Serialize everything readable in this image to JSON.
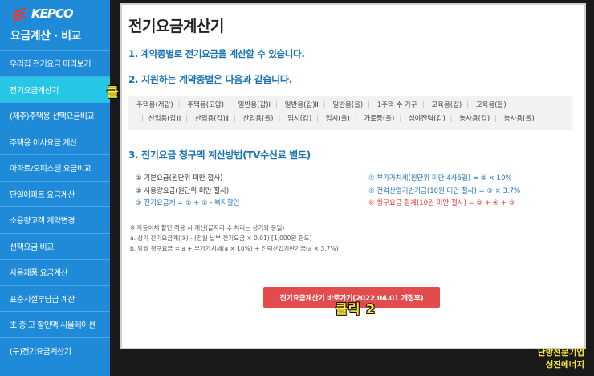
{
  "sidebar": {
    "logo_text": "KEPCO",
    "subtitle": "요금계산 · 비교",
    "items": [
      {
        "label": "우리집 전기요금 미리보기"
      },
      {
        "label": "전기요금계산기"
      },
      {
        "label": "(제주)주택용 선택요금비교"
      },
      {
        "label": "주택용 이사요금 계산"
      },
      {
        "label": "아파트/오피스텔 요금비교"
      },
      {
        "label": "단일아파트 요금계산"
      },
      {
        "label": "소용량고객 계약변경"
      },
      {
        "label": "선택요금 비교"
      },
      {
        "label": "사용제품 요금계산"
      },
      {
        "label": "표준시설부담금 계산"
      },
      {
        "label": "초·중·고 할인액 시뮬레이션"
      },
      {
        "label": "(구)전기요금계산기"
      }
    ]
  },
  "main": {
    "title": "전기요금계산기",
    "section1": "1. 계약종별로 전기요금을 계산할 수 있습니다.",
    "section2": "2. 지원하는 계약종별은 다음과 같습니다.",
    "contract_types": [
      "주택용(저압)",
      "주택용(고압)",
      "일반용(갑)Ⅰ",
      "일반용(갑)Ⅱ",
      "일반용(을)",
      "1주택 수 가구",
      "교육용(갑)",
      "교육용(을)",
      "산업용(갑)Ⅰ",
      "산업용(갑)Ⅱ",
      "산업용(을)",
      "임시(갑)",
      "임시(을)",
      "가로등(을)",
      "심야전력(갑)",
      "농사용(갑)",
      "농사용(을)"
    ],
    "section3": "3. 전기요금 청구액 계산방법(TV수신료 별도)",
    "calc_left": [
      "① 기본요금(원단위 미만 절사)",
      "② 사용량요금(원단위 미만 절사)",
      "③ 전기요금계 = ① + ② - 복지할인"
    ],
    "calc_right": [
      "④ 부가가치세(원단위 미만 4사5입) = ③ × 10%",
      "⑤ 전력산업기반기금(10원 미만 절사) = ③ × 3.7%",
      "⑥ 청구요금 합계(10원 미만 절사) = ③ + ④ + ⑤"
    ],
    "notes": [
      "※ 자동이체 할인 적용 시 계산(끝자리 수 처리는 상기와 동일)",
      "a. 상기 전기요금계(③) - (전월 납부 전기요금 × 0.01) [1,000원 한도]",
      "b. 당월 청구요금 = a + 부가가치세(a × 10%) + 전력산업기반기금(a × 3.7%)"
    ],
    "button_label": "전기요금계산기 바로가기(2022.04.01 개정후)"
  },
  "annotations": {
    "click1": "클릭 1",
    "click2": "클릭 2",
    "watermark_line1": "난방전문기업",
    "watermark_line2": "성진에너지"
  }
}
